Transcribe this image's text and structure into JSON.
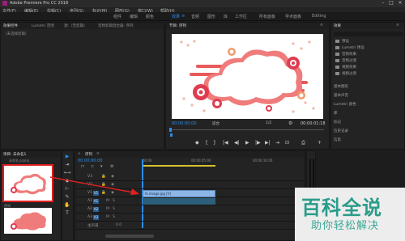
{
  "window": {
    "title": "Adobe Premiere Pro CC 2018"
  },
  "menu": [
    "文件(F)",
    "编辑(E)",
    "剪辑(C)",
    "序列(S)",
    "标记(M)",
    "图形(G)",
    "窗口(W)",
    "帮助(H)"
  ],
  "workspaces": [
    "组件",
    "编辑",
    "颜色",
    "效果",
    "音频",
    "图形",
    "库",
    "工作区",
    "所有面板",
    "学术面板",
    "Editing"
  ],
  "active_workspace": "效果",
  "source_panel": {
    "tabs": [
      "效果控件",
      "Lumetri 范围",
      "源:（无剪辑）",
      "音频剪辑混合器: 序列"
    ],
    "label": "（未选择剪辑）"
  },
  "program_monitor": {
    "tab": "节目: 序列",
    "timecode_left": "00:00:00:00",
    "fit": "适合",
    "resolution": "1/2",
    "timecode_right": "00:00:01:18",
    "controls": [
      "◆",
      "{",
      "}",
      "|◀",
      "◀|",
      "▶",
      "|▶",
      "▶|",
      "⇥",
      "⊡",
      "⎙",
      "+"
    ]
  },
  "effects_panel": {
    "tab": "效果",
    "items": [
      "预设",
      "Lumetri 预设",
      "音频效果",
      "音频过渡",
      "视频效果",
      "视频过渡"
    ],
    "sections": [
      "基本图形",
      "基本声音",
      "Lumetri 颜色",
      "库",
      "标记",
      "历史记录",
      "信息"
    ]
  },
  "project_panel": {
    "tab": "项目: 未命名1",
    "file": "未命名.prproj",
    "search": "",
    "clips": [
      "序列",
      "image"
    ]
  },
  "timeline": {
    "tab": "序列",
    "timecode": "00:00:00:00",
    "ruler": [
      "00:00",
      "00:00:05:00",
      "00:00:10:00"
    ],
    "tracks": [
      "V3",
      "V2",
      "V1",
      "A1",
      "A2",
      "A3",
      "主声道"
    ],
    "clip_label": "fx image.jpg [V]",
    "master_value": "0.0"
  },
  "watermark": {
    "main": "百科全说",
    "sub": "助你轻松解决"
  },
  "colors": {
    "accent": "#2d8ceb",
    "panel": "#232323",
    "clip": "#8cb6e6",
    "arrow": "#e02020"
  }
}
